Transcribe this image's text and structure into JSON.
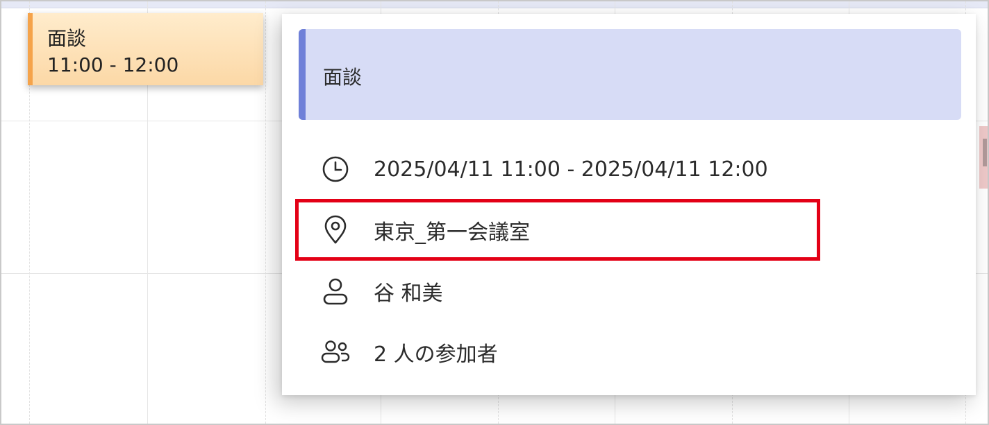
{
  "calendar_event": {
    "title": "面談",
    "time": "11:00 - 12:00"
  },
  "popup": {
    "title": "面談",
    "datetime": "2025/04/11 11:00 - 2025/04/11 12:00",
    "location": "東京_第一会議室",
    "organizer": "谷 和美",
    "attendees": "2 人の参加者",
    "icons": {
      "datetime": "clock-icon",
      "location": "location-pin-icon",
      "organizer": "person-icon",
      "attendees": "people-icon"
    }
  },
  "colors": {
    "event_accent": "#f5a34a",
    "event_fill": "#fde2b8",
    "header_accent": "#6f80d8",
    "header_fill": "#d7dcf6",
    "highlight": "#e30016"
  }
}
